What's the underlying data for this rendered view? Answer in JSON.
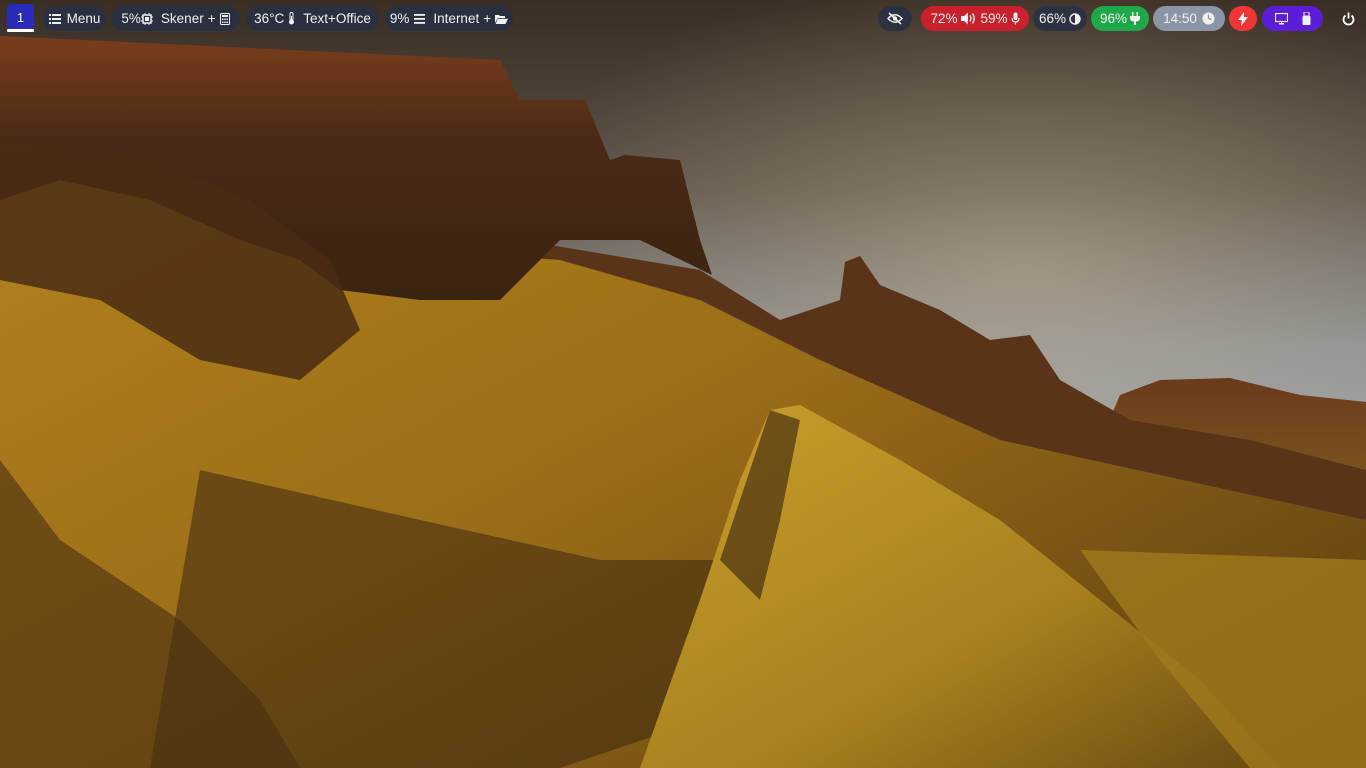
{
  "taskbar": {
    "workspace": "1",
    "menu_label": "Menu",
    "tasks": [
      {
        "cpu": "5%",
        "name": "Skener",
        "plus": "+"
      },
      {
        "temp": "36°C",
        "name": "Text+Office"
      },
      {
        "cpu": "9%",
        "name": "Internet",
        "plus": "+"
      }
    ],
    "volume": "72%",
    "mic": "59%",
    "brightness": "66%",
    "battery": "96%",
    "clock": "14:50",
    "colors": {
      "pill_dark": "#28304a",
      "audio_red": "#c8212b",
      "battery_green": "#1fa84a",
      "clock_gray": "#8a95a5",
      "lightning_red": "#ef3535",
      "display_purple": "#5b1ed6",
      "workspace_blue": "#2a2bb8"
    },
    "icons": [
      "menu-list-icon",
      "cpu-chip-icon",
      "calculator-icon",
      "thermometer-icon",
      "hamburger-icon",
      "folder-open-icon",
      "eye-slash-icon",
      "speaker-icon",
      "microphone-icon",
      "half-circle-icon",
      "plug-icon",
      "clock-icon",
      "lightning-icon",
      "monitor-icon",
      "usb-drive-icon",
      "power-icon"
    ]
  }
}
